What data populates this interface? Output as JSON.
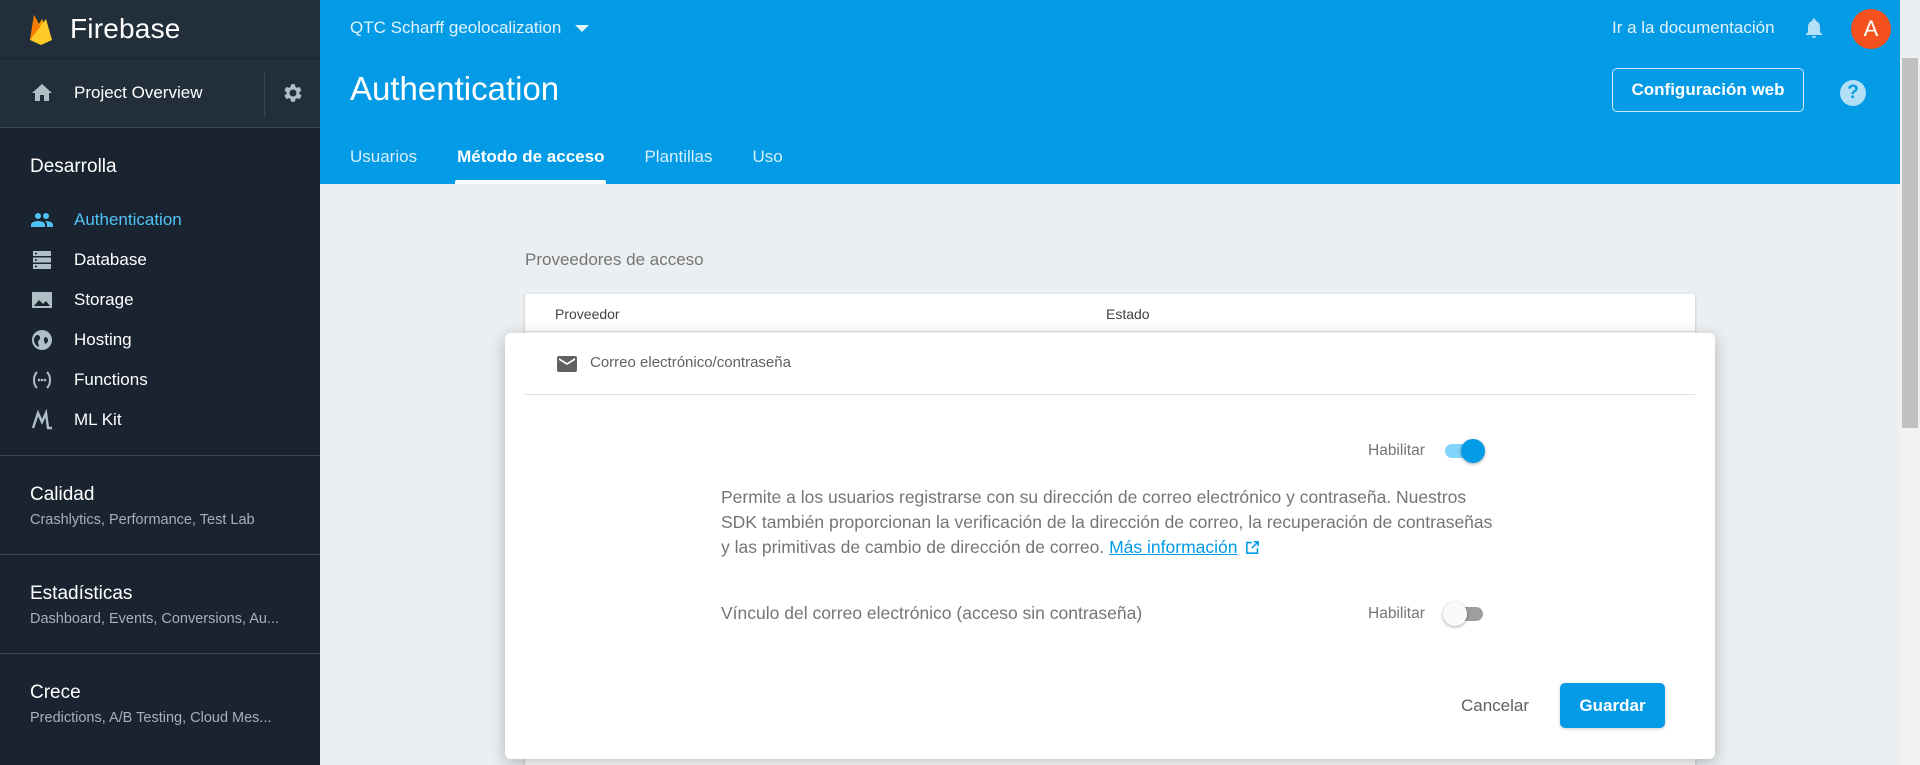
{
  "sidebar": {
    "brand": "Firebase",
    "overview": "Project Overview",
    "develop": {
      "title": "Desarrolla",
      "items": [
        {
          "label": "Authentication",
          "icon": "people-icon",
          "active": true
        },
        {
          "label": "Database",
          "icon": "database-icon"
        },
        {
          "label": "Storage",
          "icon": "image-icon"
        },
        {
          "label": "Hosting",
          "icon": "globe-icon"
        },
        {
          "label": "Functions",
          "icon": "functions-icon"
        },
        {
          "label": "ML Kit",
          "icon": "ml-kit-icon"
        }
      ]
    },
    "groups": [
      {
        "title": "Calidad",
        "sub": "Crashlytics, Performance, Test Lab"
      },
      {
        "title": "Estadísticas",
        "sub": "Dashboard, Events, Conversions, Au..."
      },
      {
        "title": "Crece",
        "sub": "Predictions, A/B Testing, Cloud Mes..."
      }
    ]
  },
  "header": {
    "project": "QTC Scharff geolocalization",
    "docs_link": "Ir a la documentación",
    "avatar_letter": "A",
    "title": "Authentication",
    "web_config": "Configuración web",
    "help": "?",
    "tabs": [
      {
        "label": "Usuarios"
      },
      {
        "label": "Método de acceso",
        "active": true
      },
      {
        "label": "Plantillas"
      },
      {
        "label": "Uso"
      }
    ]
  },
  "main": {
    "providers_label": "Proveedores de acceso",
    "table": {
      "col_provider": "Proveedor",
      "col_status": "Estado"
    },
    "dialog": {
      "provider_title": "Correo electrónico/contraseña",
      "enable_label": "Habilitar",
      "enable_on": true,
      "description": "Permite a los usuarios registrarse con su dirección de correo electrónico y contraseña. Nuestros SDK también proporcionan la verificación de la dirección de correo, la recuperación de contraseñas y las primitivas de cambio de dirección de correo.",
      "more_info": "Más información",
      "email_link_label": "Vínculo del correo electrónico (acceso sin contraseña)",
      "email_link_enable_label": "Habilitar",
      "email_link_on": false,
      "cancel": "Cancelar",
      "save": "Guardar"
    }
  },
  "colors": {
    "header_bg": "#039be5",
    "sidebar_bg": "#1a2330",
    "accent": "#039be5",
    "active_nav": "#4fc3f7",
    "avatar_bg": "#f4511e"
  }
}
